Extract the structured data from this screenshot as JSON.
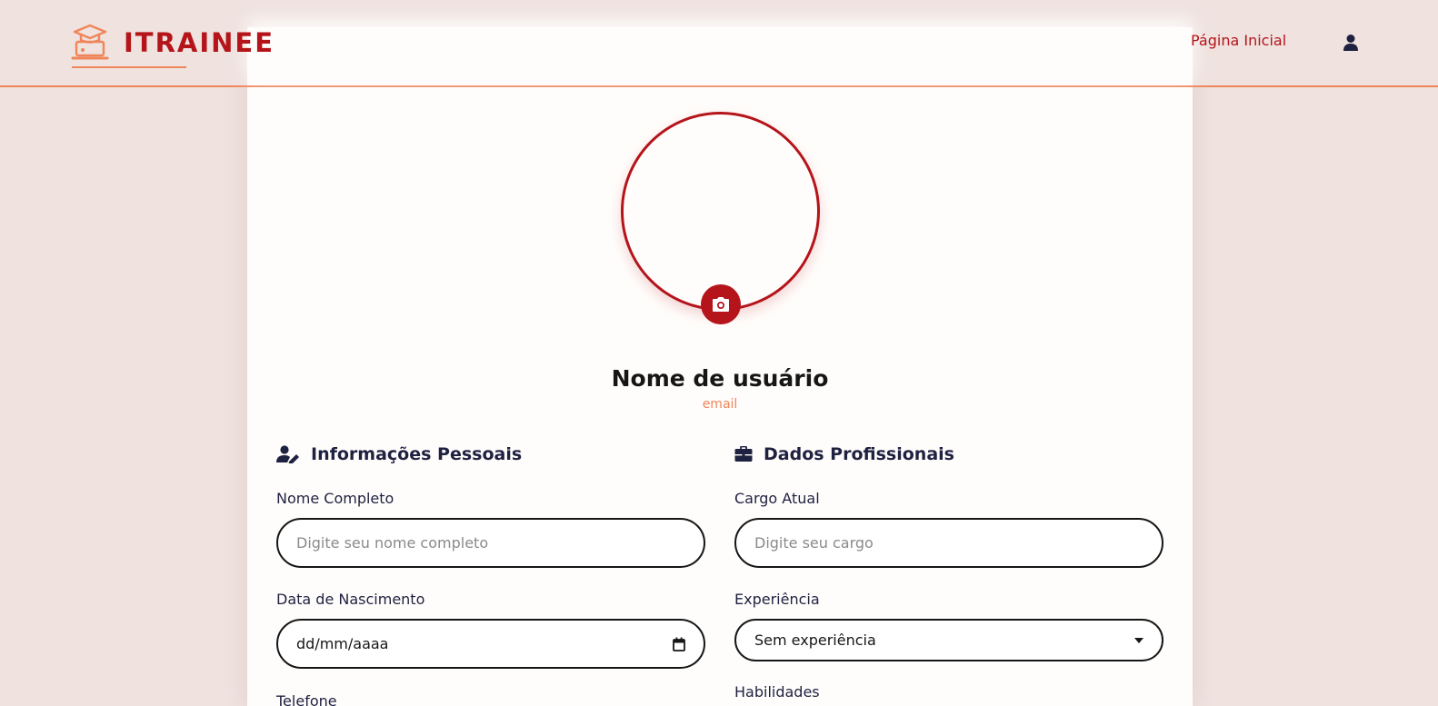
{
  "header": {
    "brand": "ITRAINEE",
    "nav_home": "Página Inicial"
  },
  "profile": {
    "username": "Nome de usuário",
    "email": "email"
  },
  "personal": {
    "title": "Informações Pessoais",
    "full_name_label": "Nome Completo",
    "full_name_placeholder": "Digite seu nome completo",
    "birth_label": "Data de Nascimento",
    "birth_value": "dd/mm/aaaa",
    "phone_label": "Telefone"
  },
  "professional": {
    "title": "Dados Profissionais",
    "role_label": "Cargo Atual",
    "role_placeholder": "Digite seu cargo",
    "experience_label": "Experiência",
    "experience_value": "Sem experiência",
    "skills_label": "Habilidades"
  },
  "colors": {
    "brand_red": "#b4141a",
    "accent_orange": "#f0855a",
    "page_bg": "#efe2df",
    "card_bg": "#fffdfb",
    "text_dark": "#1f2141"
  }
}
